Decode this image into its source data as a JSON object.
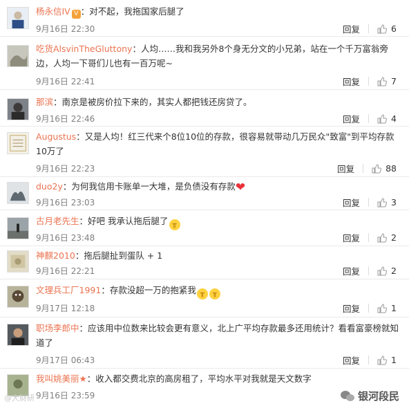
{
  "comments": [
    {
      "user": "杨永信IV",
      "badge": "V",
      "text": "：对不起，我拖国家后腿了",
      "time": "9月16日 22:30",
      "reply": "回复",
      "likes": "6",
      "avatar": "a1"
    },
    {
      "user": "吃货AlsvinTheGluttony",
      "text": "：人均……我和我另外8个身无分文的小兄弟，站在一个千万富翁旁边，人均一下哥们儿也有一百万呢~",
      "time": "9月16日 22:41",
      "reply": "回复",
      "likes": "7",
      "avatar": "a2"
    },
    {
      "user": "那滨",
      "text": "：南京是被房价拉下来的，其实人都把钱还房贷了。",
      "time": "9月16日 22:46",
      "reply": "回复",
      "likes": "4",
      "avatar": "a3"
    },
    {
      "user": "Augustus",
      "text": "：又是人均！红三代来个8位10位的存款，很容易就带动几万民众\"致富\"到平均存款10万了",
      "time": "9月16日 22:23",
      "reply": "回复",
      "likes": "88",
      "avatar": "a4"
    },
    {
      "user": "duo2y",
      "text": "：为何我信用卡账单一大堆，是负债没有存款",
      "time": "9月16日 23:03",
      "reply": "回复",
      "likes": "3",
      "avatar": "a5"
    },
    {
      "user": "古月老先生",
      "text": "：好吧 我承认拖后腿了",
      "time": "9月16日 23:48",
      "reply": "回复",
      "likes": "2",
      "avatar": "a6"
    },
    {
      "user": "神麒2010",
      "text": "：拖后腿扯到蛋队 + 1",
      "time": "9月16日 22:21",
      "reply": "回复",
      "likes": "2",
      "avatar": "a7"
    },
    {
      "user": "文理兵工厂1991",
      "text": "：存款没超一万的抱紧我",
      "time": "9月17日 12:18",
      "reply": "回复",
      "likes": "1",
      "avatar": "a8"
    },
    {
      "user": "职场李郎中",
      "text": "：应该用中位数来比较会更有意义，北上广平均存款最多还用统计？看看富豪榜就知道了",
      "time": "9月17日 06:43",
      "reply": "回复",
      "likes": "1",
      "avatar": "a9"
    },
    {
      "user": "我叫姚美丽",
      "badge": "★",
      "text": "：收入都交费北京的高房租了，平均水平对我就是天文数字",
      "time": "9月16日 23:59",
      "reply": "",
      "likes": "",
      "avatar": "a10"
    }
  ],
  "footer": {
    "watermark_left": "@大财研",
    "watermark_right": "银河段民"
  },
  "colors": {
    "username": "#eb7350",
    "text": "#333333",
    "meta": "#808080"
  }
}
